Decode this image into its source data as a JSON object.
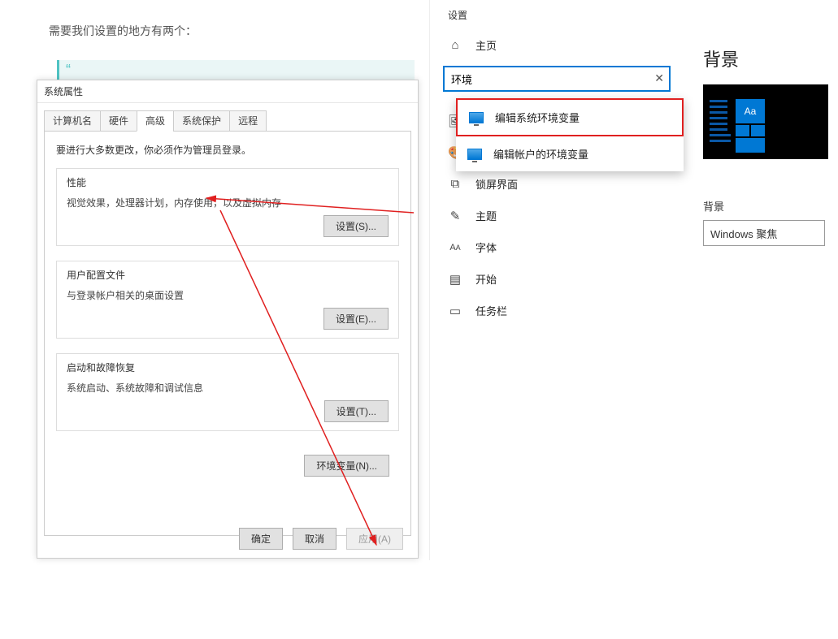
{
  "article": {
    "intro": "需要我们设置的地方有两个：",
    "quote_mark": "“"
  },
  "sysprops": {
    "title": "系统属性",
    "tabs": {
      "computer_name": "计算机名",
      "hardware": "硬件",
      "advanced": "高级",
      "system_protection": "系统保护",
      "remote": "远程"
    },
    "intro": "要进行大多数更改，你必须作为管理员登录。",
    "perf": {
      "title": "性能",
      "desc": "视觉效果，处理器计划，内存使用，以及虚拟内存",
      "btn": "设置(S)..."
    },
    "profiles": {
      "title": "用户配置文件",
      "desc": "与登录帐户相关的桌面设置",
      "btn": "设置(E)..."
    },
    "startup": {
      "title": "启动和故障恢复",
      "desc": "系统启动、系统故障和调试信息",
      "btn": "设置(T)..."
    },
    "envvar_btn": "环境变量(N)...",
    "ok": "确定",
    "cancel": "取消",
    "apply": "应用(A)"
  },
  "settings": {
    "header": "设置",
    "search_value": "环境",
    "suggest": {
      "edit_system_env": "编辑系统环境变量",
      "edit_account_env": "编辑帐户的环境变量"
    },
    "nav": {
      "home": "主页",
      "background": "背景",
      "colors": "颜色",
      "lockscreen": "锁屏界面",
      "themes": "主题",
      "fonts": "字体",
      "start": "开始",
      "taskbar": "任务栏"
    },
    "right": {
      "heading": "背景",
      "aa": "Aa",
      "label": "背景",
      "combo_value": "Windows 聚焦"
    }
  }
}
